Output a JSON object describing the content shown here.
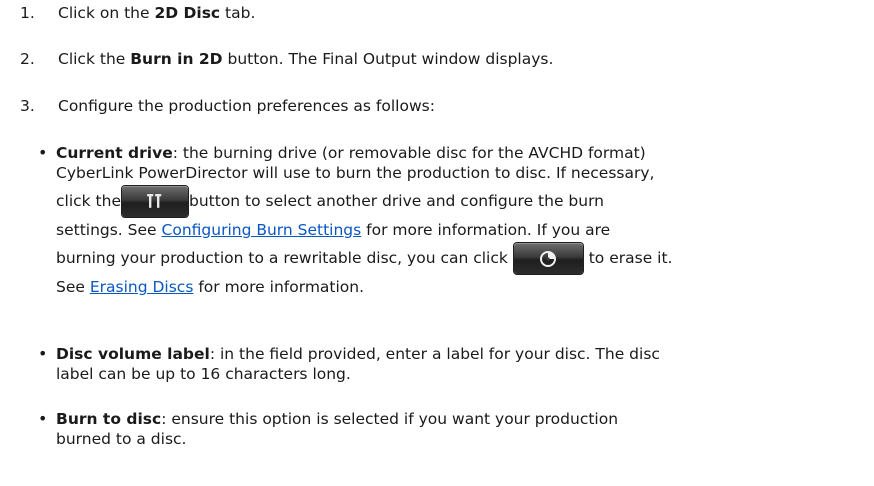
{
  "steps": [
    {
      "num": "1.",
      "pre": "Click on the ",
      "bold": "2D Disc",
      "post": " tab."
    },
    {
      "num": "2.",
      "pre": "Click the ",
      "bold": "Burn in 2D",
      "post": " button. The Final Output window displays."
    },
    {
      "num": "3.",
      "text": "Configure the production preferences as follows:"
    }
  ],
  "current_drive": {
    "term": "Current drive",
    "line1": ": the burning drive (or removable disc for the AVCHD format)",
    "line2": "CyberLink PowerDirector will use to burn the production to disc. If necessary,",
    "line3_pre": "click the",
    "line3_post": "button to select another drive and configure the burn",
    "line4_pre": "settings. See ",
    "link1": "Configuring Burn Settings",
    "line4_post": " for more information. If you are",
    "line5_pre": "burning your production to a rewritable disc, you can click",
    "line5_post": "to erase it.",
    "line6_pre": "See ",
    "link2": "Erasing Discs",
    "line6_post": " for more information."
  },
  "disc_volume_label": {
    "term": "Disc volume label",
    "line1": ": in the field provided, enter a label for your disc. The disc",
    "line2": "label can be up to 16 characters long."
  },
  "burn_to_disc": {
    "term": "Burn to disc",
    "line1": ": ensure this option is selected if you want your production",
    "line2": "burned to a disc."
  },
  "icons": {
    "settings_button": "tools-icon",
    "erase_button": "erase-disc-icon"
  }
}
